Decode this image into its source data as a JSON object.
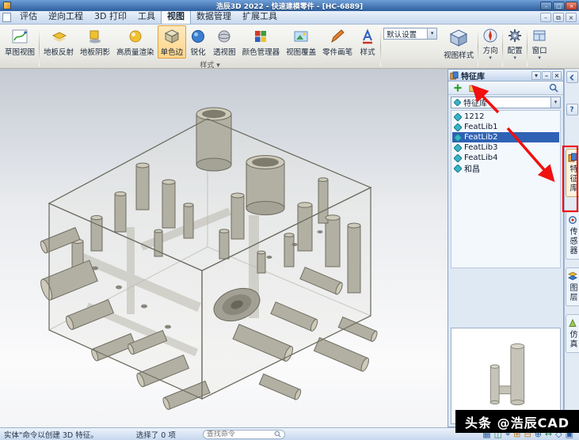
{
  "window": {
    "title": "浩辰3D 2022 - 快速建模零件 - [HC-6889]",
    "controls": {
      "min": "–",
      "max": "□",
      "close": "×"
    },
    "child_controls": {
      "min": "–",
      "restore": "⧉",
      "close": "×"
    }
  },
  "menu": {
    "tabs": [
      "评估",
      "逆向工程",
      "3D 打印",
      "工具",
      "视图",
      "数据管理",
      "扩展工具"
    ],
    "active_tab": "视图"
  },
  "ribbon": {
    "sketch_view": "草图视图",
    "floor_reflection": "地板反射",
    "floor_shadow": "地板阴影",
    "hq_render": "高质量渲染",
    "mono_edge": "单色边",
    "sharpen": "锐化",
    "perspective": "透视图",
    "color_manager": "颜色管理器",
    "view_overlay": "视图覆盖",
    "part_brush": "零件画笔",
    "style": "样式",
    "style_group": "样式",
    "default_settings": "默认设置",
    "view_style": "视图样式",
    "orientation": "方向",
    "configuration": "配置",
    "window": "窗口",
    "dropdown_arrow": "▾"
  },
  "panel": {
    "title": "特征库",
    "dropdown_value": "特征库",
    "items": [
      "1212",
      "FeatLib1",
      "FeatLib2",
      "FeatLib3",
      "FeatLib4",
      "和昌"
    ],
    "selected_item": "FeatLib2"
  },
  "rail": {
    "tabs": [
      "特征库",
      "传感器",
      "图层",
      "仿真"
    ],
    "help": "?"
  },
  "status": {
    "message": "实体\"命令以创建 3D 特征。",
    "selection": "选择了 0 项",
    "search_placeholder": "查找命令",
    "icons": [
      "▦",
      "◫",
      "⌖",
      "⊞",
      "⊟",
      "⊕",
      "↔",
      "◇",
      "▣"
    ]
  },
  "watermark": {
    "text": "头条 @浩辰CAD"
  },
  "colors": {
    "selection_blue": "#2f62b5",
    "ribbon_highlight": "#ffd488",
    "annotation_red": "#f01010",
    "titlebar_blue": "#2e5f9e"
  }
}
